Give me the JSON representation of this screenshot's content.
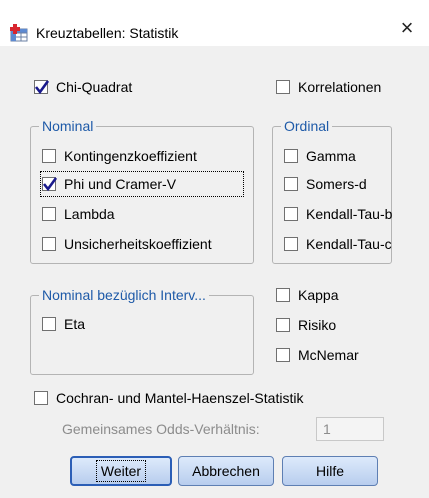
{
  "window": {
    "title": "Kreuztabellen: Statistik",
    "close_glyph": "×"
  },
  "options": {
    "chi_quadrat": {
      "label": "Chi-Quadrat",
      "checked": true
    },
    "korrelationen": {
      "label": "Korrelationen",
      "checked": false
    }
  },
  "nominal": {
    "legend": "Nominal",
    "items": [
      {
        "label": "Kontingenzkoeffizient",
        "checked": false
      },
      {
        "label": "Phi und Cramer-V",
        "checked": true
      },
      {
        "label": "Lambda",
        "checked": false
      },
      {
        "label": "Unsicherheitskoeffizient",
        "checked": false
      }
    ]
  },
  "ordinal": {
    "legend": "Ordinal",
    "items": [
      {
        "label": "Gamma",
        "checked": false
      },
      {
        "label": "Somers-d",
        "checked": false
      },
      {
        "label": "Kendall-Tau-b",
        "checked": false
      },
      {
        "label": "Kendall-Tau-c",
        "checked": false
      }
    ]
  },
  "nominal_interval": {
    "legend": "Nominal bezüglich Interv...",
    "items": [
      {
        "label": "Eta",
        "checked": false
      }
    ]
  },
  "other": {
    "items": [
      {
        "label": "Kappa",
        "checked": false
      },
      {
        "label": "Risiko",
        "checked": false
      },
      {
        "label": "McNemar",
        "checked": false
      }
    ]
  },
  "cochran": {
    "label": "Cochran- und Mantel-Haenszel-Statistik",
    "checked": false,
    "odds_label": "Gemeinsames Odds-Verhältnis:",
    "odds_value": "1"
  },
  "buttons": {
    "continue": "Weiter",
    "cancel": "Abbrechen",
    "help": "Hilfe"
  },
  "colors": {
    "group_legend": "#1e5aa8",
    "button_border": "#2b5eb6",
    "checkmark": "#1a1a8c"
  },
  "icons": {
    "app": "spss-table-icon",
    "close": "close-icon",
    "check": "checkmark-icon"
  }
}
